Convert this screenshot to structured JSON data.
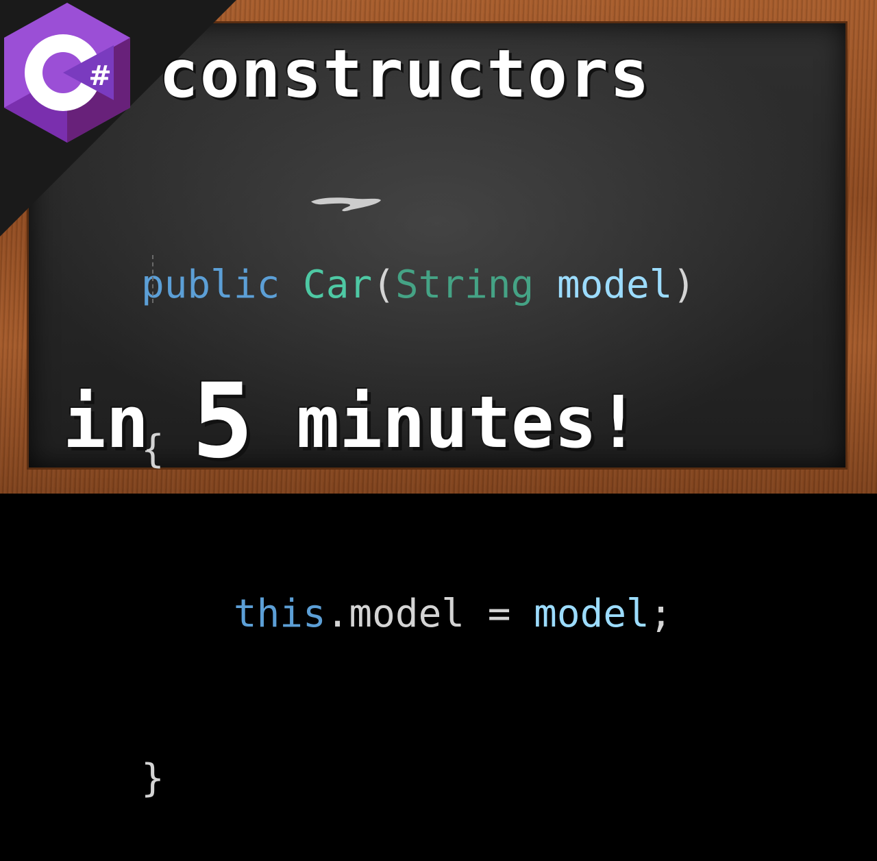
{
  "logo": {
    "icon": "csharp-logo-icon",
    "letter": "C",
    "symbol": "#"
  },
  "title": "constructors",
  "code": {
    "line1": {
      "kw": "public",
      "space1": " ",
      "class_name": "Car",
      "open_paren": "(",
      "param_type": "String",
      "space2": " ",
      "param_name": "model",
      "close_paren": ")"
    },
    "line2": "{",
    "line3": {
      "indent": "    ",
      "this_kw": "this",
      "dot_member": ".model",
      "op": " = ",
      "value": "model",
      "semi": ";"
    },
    "line4": "}"
  },
  "bottom": {
    "part1": "in ",
    "number": "5",
    "part2": " minutes!"
  },
  "colors": {
    "keyword": "#5c9fd6",
    "type": "#4ec9a4",
    "identifier": "#9cdcfe",
    "frame": "#a85d2c",
    "board": "#2a2a2a"
  }
}
